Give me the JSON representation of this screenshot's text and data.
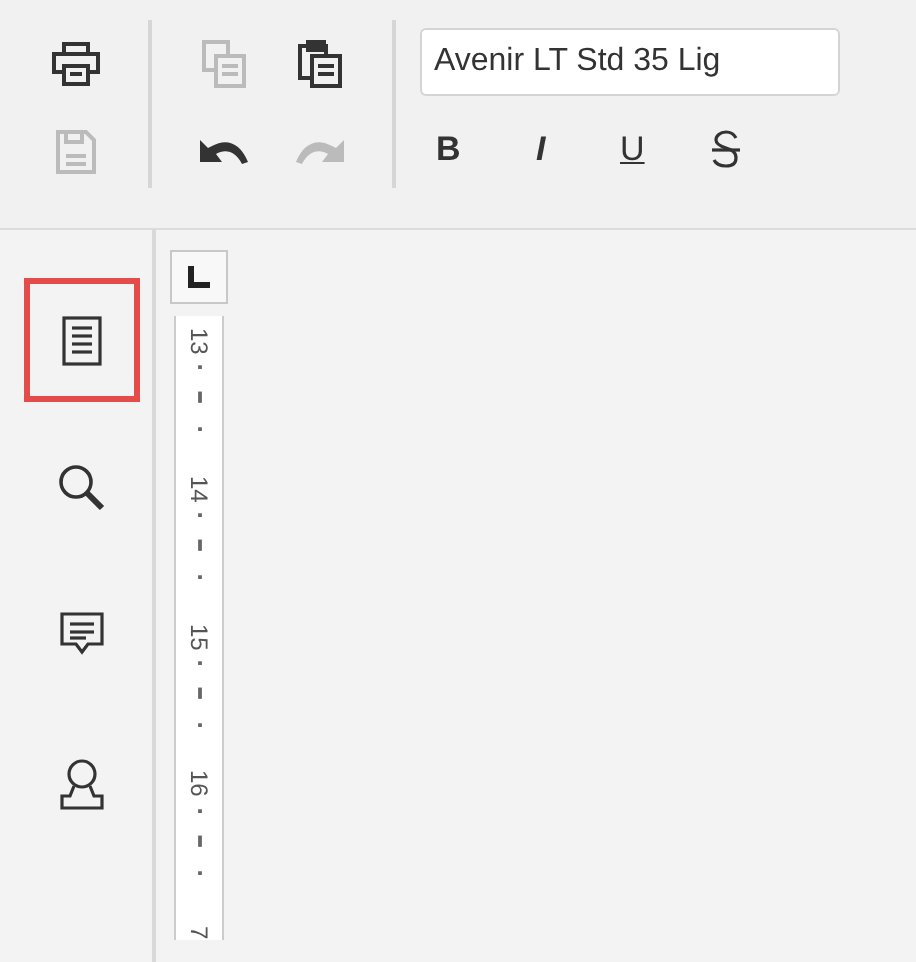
{
  "toolbar": {
    "groups": [
      {
        "buttons": [
          {
            "kind": "print",
            "disabled": false
          },
          {
            "kind": "save",
            "disabled": true
          }
        ]
      },
      {
        "buttons": [
          {
            "kind": "copy",
            "disabled": true
          },
          {
            "kind": "paste",
            "disabled": false
          },
          {
            "kind": "undo",
            "disabled": false
          },
          {
            "kind": "redo",
            "disabled": true
          }
        ]
      }
    ],
    "font": {
      "value": "Avenir LT Std 35 Lig"
    },
    "format_buttons": [
      {
        "kind": "bold",
        "label": "B"
      },
      {
        "kind": "italic",
        "label": "I"
      },
      {
        "kind": "underline",
        "label": "U"
      },
      {
        "kind": "strike"
      }
    ]
  },
  "sidebar": {
    "items": [
      {
        "kind": "document",
        "selected": true
      },
      {
        "kind": "search",
        "selected": false
      },
      {
        "kind": "comment",
        "selected": false
      },
      {
        "kind": "person",
        "selected": false
      }
    ]
  },
  "ruler": {
    "labels": [
      "13",
      "14",
      "15",
      "16",
      "7"
    ]
  }
}
